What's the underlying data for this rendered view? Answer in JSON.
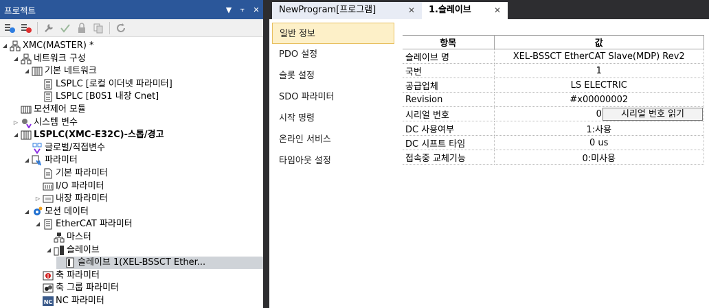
{
  "project_panel": {
    "title": "프로젝트",
    "controls": {
      "dropdown": "▼",
      "pin": "⫟",
      "close": "✕"
    },
    "toolbar_icons": [
      "filter-icon",
      "filter-off-icon",
      "wrench-icon",
      "check-icon",
      "lock-icon",
      "copy-icon",
      "refresh-icon"
    ]
  },
  "tree": [
    {
      "label": "XMC(MASTER) *",
      "icon": "network-icon",
      "exp": "◢",
      "level": 0
    },
    {
      "label": "네트워크 구성",
      "icon": "network-icon",
      "exp": "◢",
      "level": 1
    },
    {
      "label": "기본 네트워크",
      "icon": "grid-icon",
      "exp": "◢",
      "level": 2
    },
    {
      "label": "LSPLC [로컬 이더넷 파라미터]",
      "icon": "plc-icon",
      "exp": "",
      "level": 3
    },
    {
      "label": "LSPLC [B0S1 내장 Cnet]",
      "icon": "plc-icon",
      "exp": "",
      "level": 3
    },
    {
      "label": "모션제어 모듈",
      "icon": "module-icon",
      "exp": "",
      "level": 1
    },
    {
      "label": "시스템 변수",
      "icon": "variable-icon",
      "exp": "▷",
      "level": 1
    },
    {
      "label": "LSPLC(XMC-E32C)-스톱/경고",
      "icon": "grid-icon",
      "exp": "◢",
      "level": 1,
      "bold": true
    },
    {
      "label": "글로벌/직접변수",
      "icon": "global-var-icon",
      "exp": "",
      "level": 2
    },
    {
      "label": "파라미터",
      "icon": "parameter-icon",
      "exp": "◢",
      "level": 2
    },
    {
      "label": "기본 파라미터",
      "icon": "document-icon",
      "exp": "",
      "level": 3
    },
    {
      "label": "I/O 파라미터",
      "icon": "io-icon",
      "exp": "",
      "level": 3
    },
    {
      "label": "내장 파라미터",
      "icon": "builtin-icon",
      "exp": "▷",
      "level": 3
    },
    {
      "label": "모션 데이터",
      "icon": "gear-icon",
      "exp": "◢",
      "level": 2
    },
    {
      "label": "EtherCAT 파라미터",
      "icon": "ethercat-icon",
      "exp": "◢",
      "level": 3
    },
    {
      "label": "마스터",
      "icon": "master-icon",
      "exp": "",
      "level": 4
    },
    {
      "label": "슬레이브",
      "icon": "slave-icon",
      "exp": "◢",
      "level": 4
    },
    {
      "label": "슬레이브  1(XEL-BSSCT Ether...",
      "icon": "slave-item-icon",
      "exp": "",
      "level": 5,
      "selected": true
    },
    {
      "label": "축 파라미터",
      "icon": "axis-icon",
      "exp": "",
      "level": 3
    },
    {
      "label": "축 그룹 파라미터",
      "icon": "axis-group-icon",
      "exp": "",
      "level": 3
    },
    {
      "label": "NC 파라미터",
      "icon": "nc-icon",
      "exp": "",
      "level": 3
    }
  ],
  "tabs": [
    {
      "label": "NewProgram[프로그램]",
      "close": "✕"
    },
    {
      "label": "1.슬레이브",
      "close": "✕"
    }
  ],
  "categories": [
    {
      "label": "일반 정보",
      "selected": true
    },
    {
      "label": "PDO 설정"
    },
    {
      "label": "슬롯 설정"
    },
    {
      "label": "SDO 파라미터"
    },
    {
      "label": "시작 명령"
    },
    {
      "label": "온라인 서비스"
    },
    {
      "label": "타임아웃 설정"
    }
  ],
  "properties": {
    "headers": [
      "항목",
      "값"
    ],
    "rows": [
      {
        "name": "슬레이브 명",
        "value": "XEL-BSSCT EtherCAT Slave(MDP) Rev2"
      },
      {
        "name": "국번",
        "value": "1"
      },
      {
        "name": "공급업체",
        "value": "LS ELECTRIC"
      },
      {
        "name": "Revision",
        "value": "#x00000002"
      },
      {
        "name": "시리얼 번호",
        "value": "0",
        "button": "시리얼 번호 읽기"
      },
      {
        "name": "DC 사용여부",
        "value": "1:사용"
      },
      {
        "name": "DC 시프트 타임",
        "value": "0 us"
      },
      {
        "name": "접속중 교체기능",
        "value": "0:미사용"
      }
    ]
  },
  "colors": {
    "title_bar": "#2b579a",
    "selected_category_bg": "#fdf0c8",
    "selected_tree_bg": "#cfd3d8"
  }
}
